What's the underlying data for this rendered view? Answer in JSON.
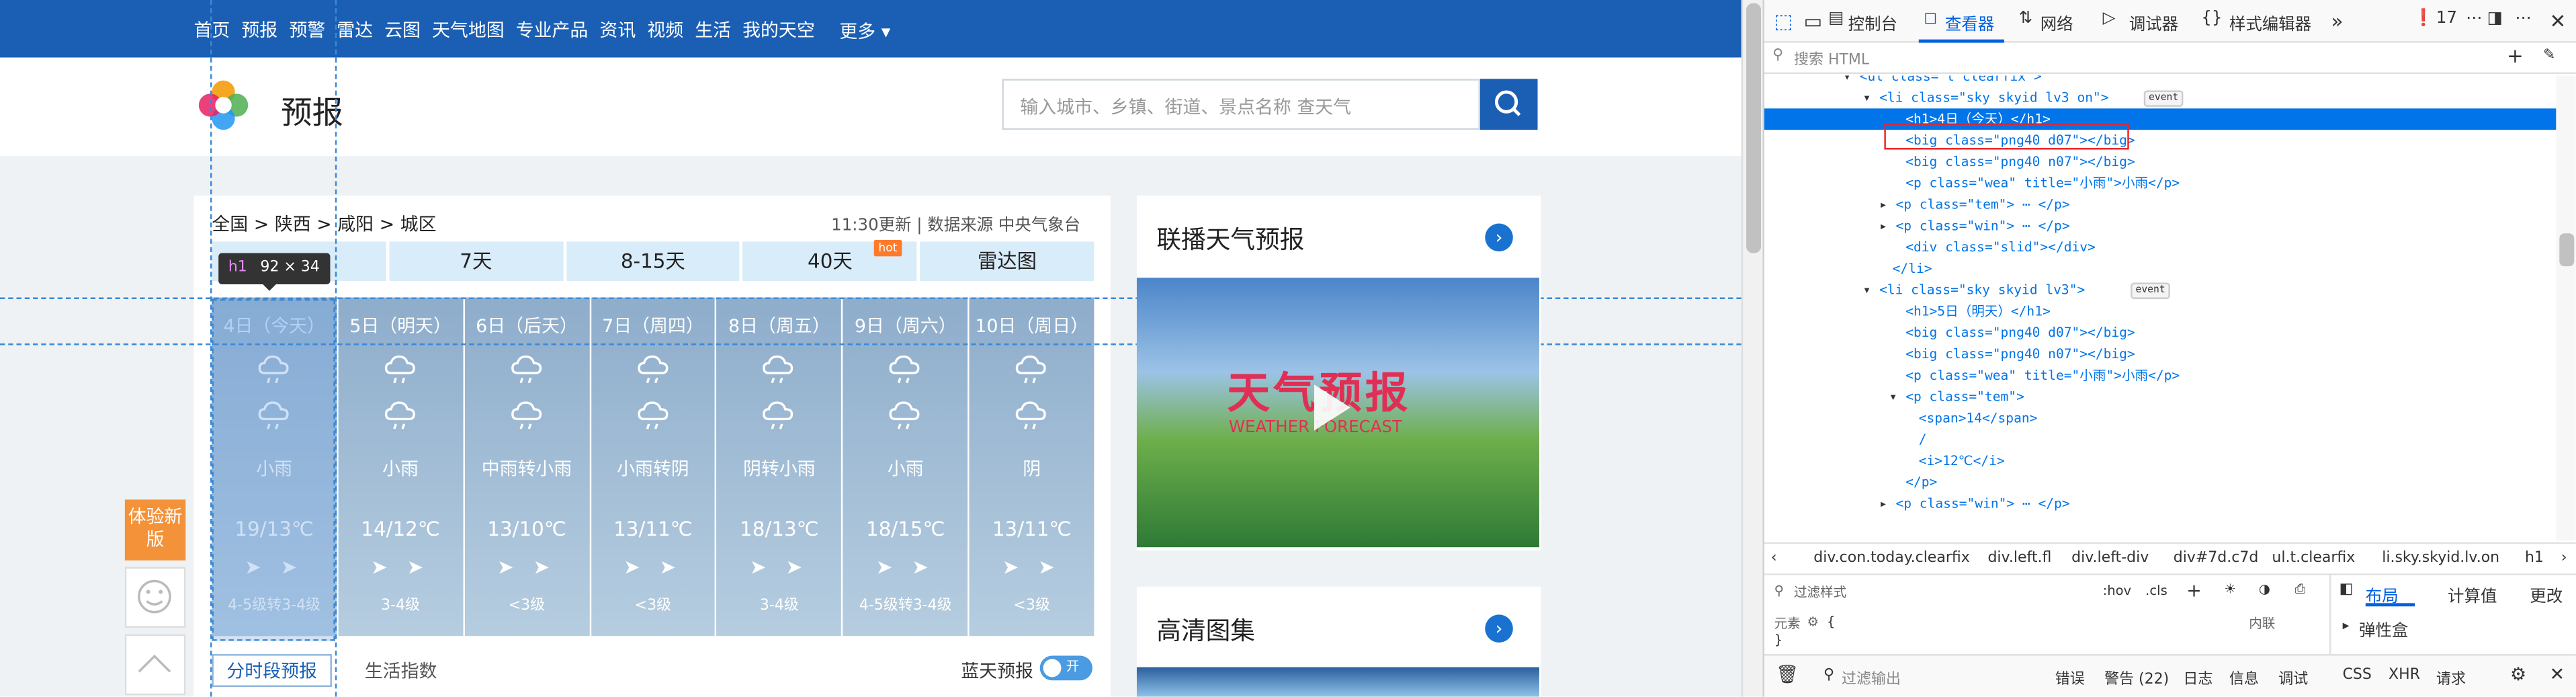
{
  "nav": {
    "items": [
      "首页",
      "预报",
      "预警",
      "雷达",
      "云图",
      "天气地图",
      "专业产品",
      "资讯",
      "视频",
      "生活",
      "我的天空"
    ],
    "more": "更多 ▾"
  },
  "header": {
    "logo_text": "预报",
    "search_placeholder": "输入城市、乡镇、街道、景点名称 查天气"
  },
  "breadcrumb": "全国 > 陕西 > 咸阳 > 城区",
  "update": "11:30更新 | 数据来源 中央气象台",
  "tabs": [
    "",
    "7天",
    "8-15天",
    "40天",
    "雷达图"
  ],
  "tab_hot": "hot",
  "days": [
    {
      "h": "4日（今天）",
      "w": "小雨",
      "t": "19/13℃",
      "ar": "➤ ➤",
      "wl": "4-5级转3-4级"
    },
    {
      "h": "5日（明天）",
      "w": "小雨",
      "t": "14/12℃",
      "ar": "➤ ➤",
      "wl": "3-4级"
    },
    {
      "h": "6日（后天）",
      "w": "中雨转小雨",
      "t": "13/10℃",
      "ar": "➤ ➤",
      "wl": "<3级"
    },
    {
      "h": "7日（周四）",
      "w": "小雨转阴",
      "t": "13/11℃",
      "ar": "➤ ➤",
      "wl": "<3级"
    },
    {
      "h": "8日（周五）",
      "w": "阴转小雨",
      "t": "18/13℃",
      "ar": "➤ ➤",
      "wl": "3-4级"
    },
    {
      "h": "9日（周六）",
      "w": "小雨",
      "t": "18/15℃",
      "ar": "➤ ➤",
      "wl": "4-5级转3-4级"
    },
    {
      "h": "10日（周日）",
      "w": "阴",
      "t": "13/11℃",
      "ar": "➤ ➤",
      "wl": "<3级"
    }
  ],
  "subtabs": {
    "hourly": "分时段预报",
    "life": "生活指数",
    "blue": "蓝天预报",
    "toggle": "开"
  },
  "right": {
    "broadcast": "联播天气预报",
    "video_title": "天气预报",
    "video_sub": "WEATHER FORECAST",
    "gallery": "高清图集"
  },
  "float": {
    "try": "体验新版"
  },
  "tooltip": {
    "tag": "h1",
    "size": "92 × 34"
  },
  "devtools": {
    "tabs": [
      "控制台",
      "查看器",
      "网络",
      "调试器",
      "样式编辑器"
    ],
    "errors": "17",
    "search": "搜索 HTML",
    "tree": [
      "<ul class=\"t clearfix\">",
      "<li class=\"sky skyid lv3 on\">",
      "<h1>4日（今天）</h1>",
      "<big class=\"png40 d07\"></big>",
      "<big class=\"png40 n07\"></big>",
      "<p class=\"wea\" title=\"小雨\">小雨</p>",
      "<p class=\"tem\"> ⋯ </p>",
      "<p class=\"win\"> ⋯ </p>",
      "<div class=\"slid\"></div>",
      "</li>",
      "<li class=\"sky skyid lv3\">",
      "<h1>5日（明天）</h1>",
      "<big class=\"png40 d07\"></big>",
      "<big class=\"png40 n07\"></big>",
      "<p class=\"wea\" title=\"小雨\">小雨</p>",
      "<p class=\"tem\">",
      "<span>14</span>",
      "/",
      "<i>12℃</i>",
      "</p>",
      "<p class=\"win\"> ⋯ </p>"
    ],
    "event": "event",
    "breadcrumbs": [
      "div.con.today.clearfix",
      "div.left.fl",
      "div.left-div",
      "div#7d.c7d",
      "ul.t.clearfix",
      "li.sky.skyid.lv.on",
      "h1"
    ],
    "filter_styles": "过滤样式",
    "hov": ":hov",
    "cls": ".cls",
    "element": "元素",
    "brace_open": "{",
    "brace_close": "}",
    "inline": "内联",
    "layout_tabs": [
      "布局",
      "计算值",
      "更改"
    ],
    "flexbox": "弹性盒",
    "console": {
      "filter": "过滤输出",
      "buttons": [
        "错误",
        "警告 (22)",
        "日志",
        "信息",
        "调试",
        "CSS",
        "XHR",
        "请求"
      ]
    }
  }
}
